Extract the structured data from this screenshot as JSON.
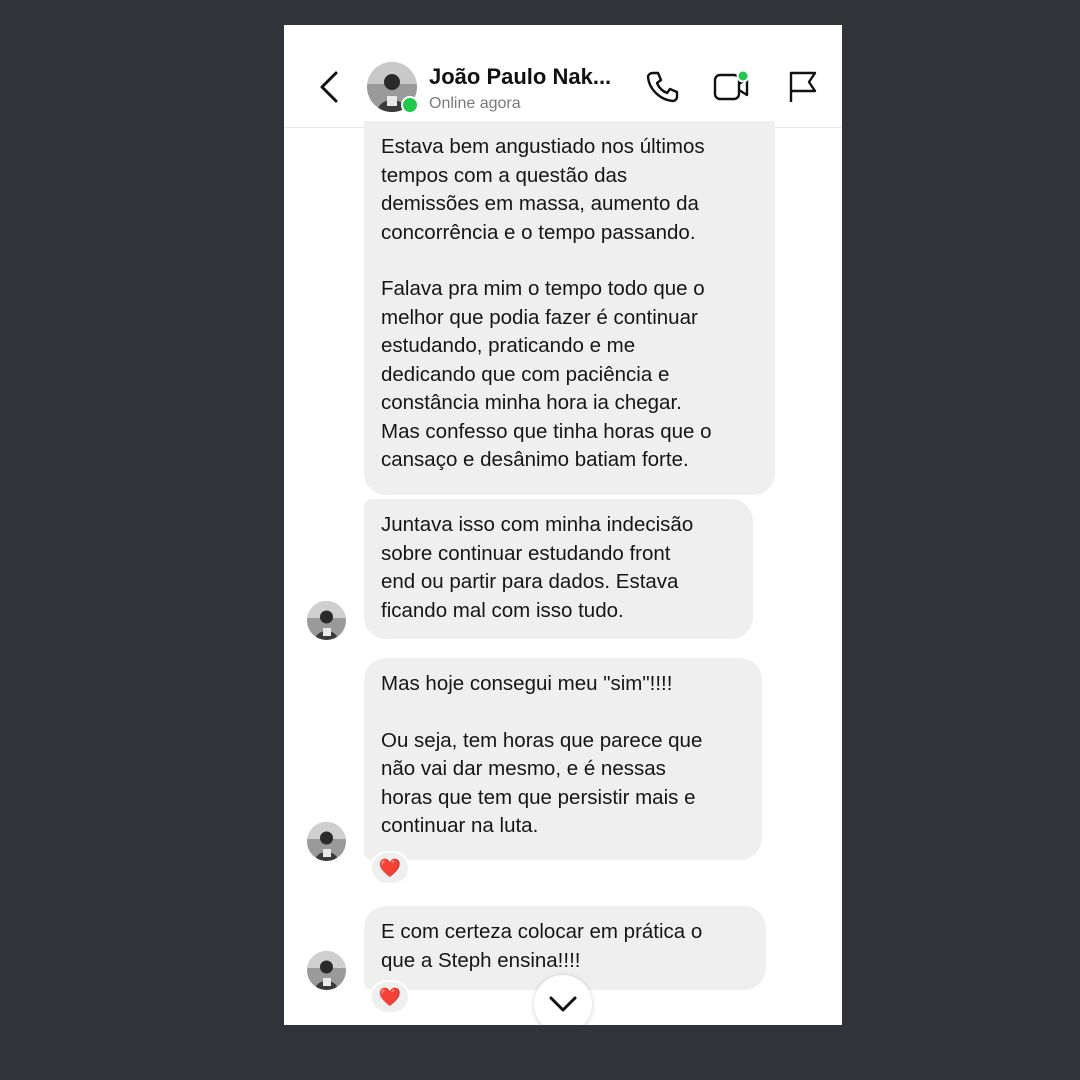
{
  "header": {
    "contact_name": "João Paulo Nak...",
    "status": "Online agora",
    "online_color": "#1fc94a",
    "icons": [
      "back-arrow-icon",
      "avatar",
      "phone-call-icon",
      "video-call-icon",
      "flag-icon"
    ]
  },
  "messages": [
    {
      "paragraphs": [
        "Estava bem angustiado nos últimos\ntempos com a questão das\ndemissões em massa, aumento da\nconcorrência e o tempo passando.",
        "Falava pra mim o tempo todo que o\nmelhor que podia fazer é continuar\nestudando, praticando e me\ndedicando que com paciência e\nconstância minha hora ia chegar.\nMas confesso que tinha horas que o\ncansaço e desânimo batiam forte."
      ]
    },
    {
      "paragraphs": [
        "Juntava isso com minha indecisão\nsobre continuar estudando front\nend ou partir para dados. Estava\nficando mal com isso tudo."
      ]
    },
    {
      "paragraphs": [
        "Mas hoje consegui meu \"sim\"!!!!",
        "Ou seja, tem horas que parece que\nnão vai dar mesmo, e é nessas\nhoras que tem que persistir mais e\ncontinuar na luta."
      ],
      "reaction": "❤️"
    },
    {
      "paragraphs": [
        "E com certeza colocar em prática o\nque a Steph ensina!!!!"
      ],
      "reaction": "❤️"
    }
  ],
  "scroll_button_icon": "chevron-down-icon"
}
